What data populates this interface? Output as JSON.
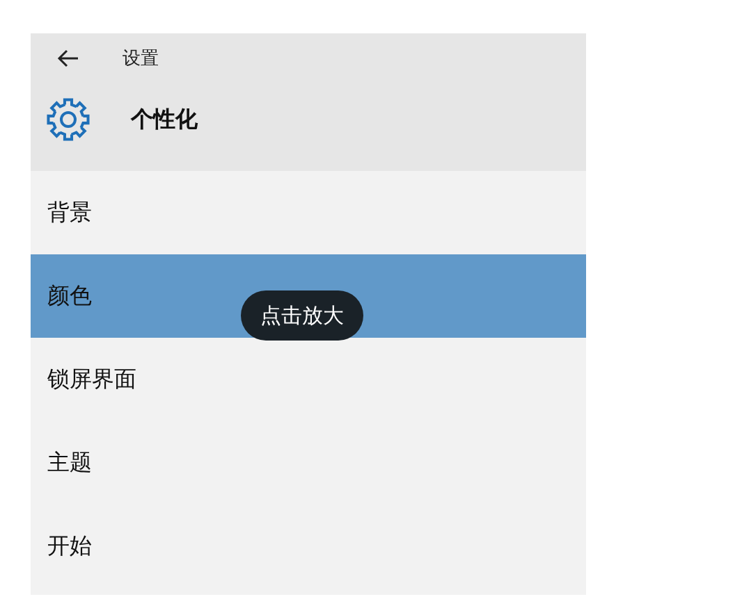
{
  "header": {
    "back_label": "设置",
    "title": "个性化"
  },
  "items": [
    {
      "label": "背景",
      "selected": false
    },
    {
      "label": "颜色",
      "selected": true
    },
    {
      "label": "锁屏界面",
      "selected": false
    },
    {
      "label": "主题",
      "selected": false
    },
    {
      "label": "开始",
      "selected": false
    }
  ],
  "tooltip": "点击放大"
}
